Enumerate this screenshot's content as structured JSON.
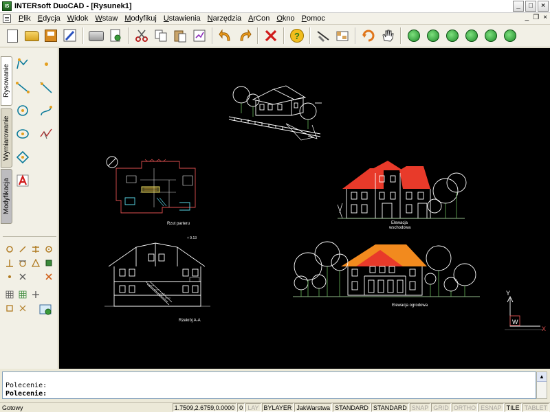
{
  "window": {
    "title": "INTERsoft DuoCAD - [Rysunek1]",
    "logo_text": "IS",
    "minimize": "_",
    "maximize": "□",
    "close": "×"
  },
  "menu": {
    "items": [
      {
        "label": "Plik",
        "mnemonic": "P",
        "rest": "lik"
      },
      {
        "label": "Edycja",
        "mnemonic": "E",
        "rest": "dycja"
      },
      {
        "label": "Widok",
        "mnemonic": "W",
        "rest": "idok"
      },
      {
        "label": "Wstaw",
        "mnemonic": "W",
        "rest": "staw"
      },
      {
        "label": "Modyfikuj",
        "mnemonic": "M",
        "rest": "odyfikuj"
      },
      {
        "label": "Ustawienia",
        "mnemonic": "U",
        "rest": "stawienia"
      },
      {
        "label": "Narzędzia",
        "mnemonic": "N",
        "rest": "arzędzia"
      },
      {
        "label": "ArCon",
        "mnemonic": "A",
        "rest": "rCon"
      },
      {
        "label": "Okno",
        "mnemonic": "O",
        "rest": "kno"
      },
      {
        "label": "Pomoc",
        "mnemonic": "P",
        "rest": "omoc"
      }
    ],
    "mdi_minimize": "_",
    "mdi_restore": "❐",
    "mdi_close": "×"
  },
  "toolbar": {
    "icons": [
      "new-icon",
      "open-icon",
      "save-icon",
      "pen-icon",
      "print-icon",
      "print-preview-icon",
      "cut-icon",
      "copy-icon",
      "paste-icon",
      "properties-icon",
      "undo-icon",
      "redo-icon",
      "delete-icon",
      "help-icon",
      "match-properties-icon",
      "layers-icon",
      "rotate-view-icon",
      "pan-icon",
      "zoom-in-icon",
      "zoom-out-icon",
      "zoom-window-icon",
      "zoom-extents-icon",
      "zoom-previous-icon",
      "zoom-realtime-icon"
    ],
    "help_glyph": "?"
  },
  "left_panel": {
    "tabs": [
      "Rysowanie",
      "Wymiarowanie",
      "Modyfikacja"
    ]
  },
  "drawing": {
    "labels": {
      "plan": "Rzut parteru",
      "side_elevation_1": "Elewacja",
      "side_elevation_2": "wschodowa",
      "section": "Rzekrój A-A",
      "garden_elevation": "Elewacja ogrodowa",
      "level": "+ 9.13",
      "ucs_x": "X",
      "ucs_y": "Y",
      "ucs_w": "W"
    },
    "colors": {
      "line": "#ffffff",
      "tree": "#ffffff",
      "roof_red": "#e83a2a",
      "roof_orange": "#f28a1e",
      "plan_red": "#e05050",
      "plan_yellow": "#f0e060",
      "plan_cyan": "#5ad7e8",
      "grass": "#69b85a"
    }
  },
  "command": {
    "line1": "Polecenie:",
    "line2": "Polecenie:"
  },
  "status": {
    "ready": "Gotowy",
    "coords": "1.7509,2.6759,0.0000",
    "zero": "0",
    "lay": "LAY",
    "bylayer": "BYLAYER",
    "layer": "JakWarstwa",
    "style1": "STANDARD",
    "style2": "STANDARD",
    "snap": "SNAP",
    "grid": "GRID",
    "ortho": "ORTHO",
    "esnap": "ESNAP",
    "tile": "TILE",
    "tablet": "TABLET"
  }
}
